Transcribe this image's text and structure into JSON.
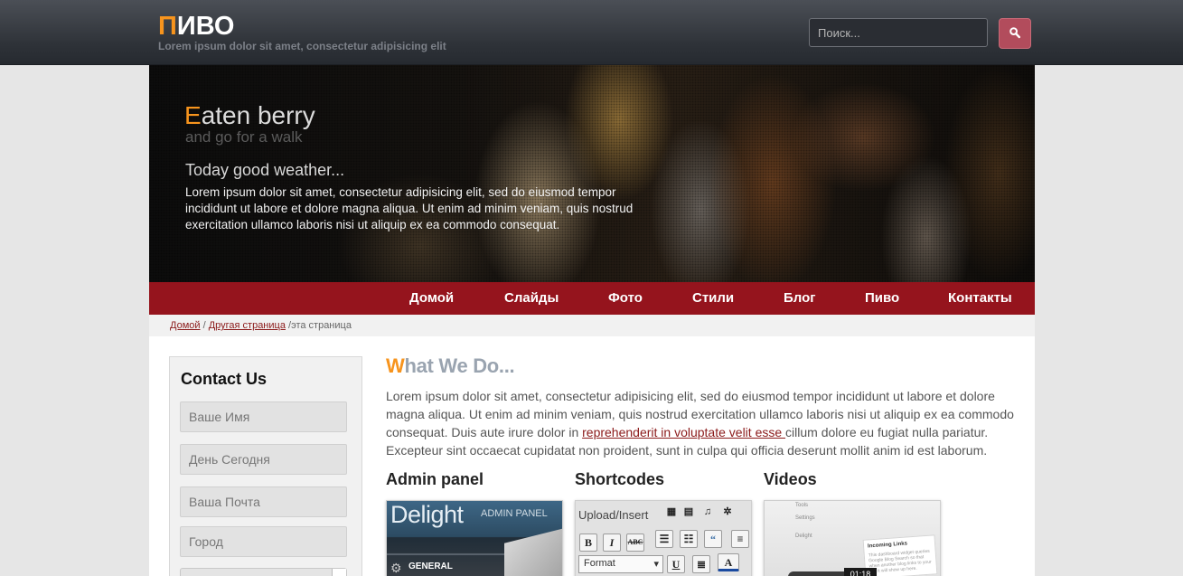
{
  "header": {
    "logo_first": "П",
    "logo_rest": "ИВО",
    "tagline": "Lorem ipsum dolor sit amet, consectetur adipisicing elit",
    "search_placeholder": "Поиск...",
    "search_icon": "search-icon"
  },
  "hero": {
    "title_first": "E",
    "title_rest": "aten berry",
    "subtitle": "and go for a walk",
    "heading": "Today good weather...",
    "text": "Lorem ipsum dolor sit amet, consectetur adipisicing elit, sed do eiusmod tempor incididunt ut labore et dolore magna aliqua. Ut enim ad minim veniam, quis nostrud exercitation ullamco laboris nisi ut aliquip ex ea commodo consequat."
  },
  "nav": {
    "items": [
      "Домой",
      "Слайды",
      "Фото",
      "Стили",
      "Блог",
      "Пиво",
      "Контакты"
    ]
  },
  "breadcrumb": {
    "home": "Домой",
    "sep1": " / ",
    "other": "Другая страница",
    "sep2": " /",
    "current": "эта страница"
  },
  "contact": {
    "title": "Contact Us",
    "fields": {
      "name": "Ваше Имя",
      "date": "День Сегодня",
      "email": "Ваша Почта",
      "city": "Город"
    }
  },
  "main": {
    "title_first": "W",
    "title_rest": "hat We Do...",
    "text_before": "Lorem ipsum dolor sit amet, consectetur adipisicing elit, sed do eiusmod tempor incididunt ut labore et dolore magna aliqua. Ut enim ad minim veniam, quis nostrud exercitation ullamco laboris nisi ut aliquip ex ea commodo consequat. Duis aute irure dolor in ",
    "link": "reprehenderit in voluptate velit esse ",
    "text_after": "cillum dolore eu fugiat nulla pariatur. Excepteur sint occaecat cupidatat non proident, sunt in culpa qui officia deserunt mollit anim id est laborum."
  },
  "features": [
    {
      "title": "Admin panel",
      "thumb": {
        "line1": "Delight",
        "line2": "ADMIN PANEL",
        "line3": "GENERAL"
      }
    },
    {
      "title": "Shortcodes",
      "thumb": {
        "line1": "Upload/Insert",
        "format": "Format"
      }
    },
    {
      "title": "Videos",
      "thumb": {
        "tools": "Tools",
        "settings": "Settings",
        "delight": "Delight",
        "box_title": "Incoming Links",
        "box_text": "This dashboard widget queries Google Blog Search so that when another blog links to your site it will show up here.",
        "time": "01:18"
      }
    }
  ],
  "colors": {
    "accent_orange": "#f7941d",
    "nav_red": "#95141d",
    "search_button": "#b24c5c",
    "link_red": "#8b1a1a"
  }
}
